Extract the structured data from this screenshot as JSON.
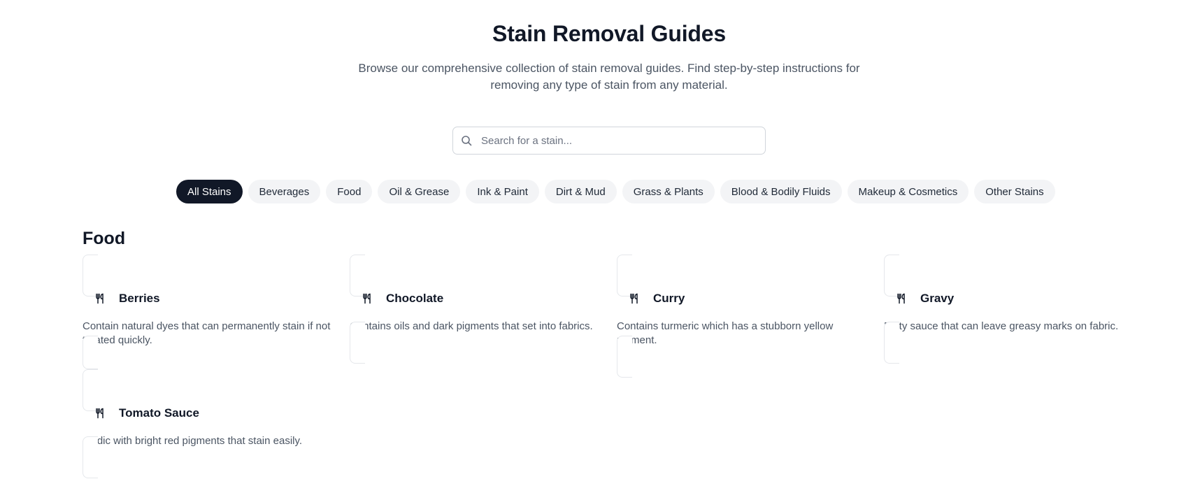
{
  "header": {
    "title": "Stain Removal Guides",
    "subtitle": "Browse our comprehensive collection of stain removal guides. Find step-by-step instructions for removing any type of stain from any material."
  },
  "search": {
    "placeholder": "Search for a stain...",
    "value": ""
  },
  "filters": [
    {
      "label": "All Stains",
      "active": true
    },
    {
      "label": "Beverages",
      "active": false
    },
    {
      "label": "Food",
      "active": false
    },
    {
      "label": "Oil & Grease",
      "active": false
    },
    {
      "label": "Ink & Paint",
      "active": false
    },
    {
      "label": "Dirt & Mud",
      "active": false
    },
    {
      "label": "Grass & Plants",
      "active": false
    },
    {
      "label": "Blood & Bodily Fluids",
      "active": false
    },
    {
      "label": "Makeup & Cosmetics",
      "active": false
    },
    {
      "label": "Other Stains",
      "active": false
    }
  ],
  "section": {
    "title": "Food",
    "cards": [
      {
        "name": "Berries",
        "icon": "utensils-icon",
        "description": "Contain natural dyes that can permanently stain if not treated quickly."
      },
      {
        "name": "Chocolate",
        "icon": "utensils-icon",
        "description": "Contains oils and dark pigments that set into fabrics."
      },
      {
        "name": "Curry",
        "icon": "utensils-icon",
        "description": "Contains turmeric which has a stubborn yellow pigment."
      },
      {
        "name": "Gravy",
        "icon": "utensils-icon",
        "description": "Fatty sauce that can leave greasy marks on fabric."
      },
      {
        "name": "Tomato Sauce",
        "icon": "utensils-icon",
        "description": "Acidic with bright red pigments that stain easily."
      }
    ]
  },
  "colors": {
    "active_pill": "#111827",
    "pill_bg": "#f3f4f6",
    "body_text": "#4b5563"
  }
}
